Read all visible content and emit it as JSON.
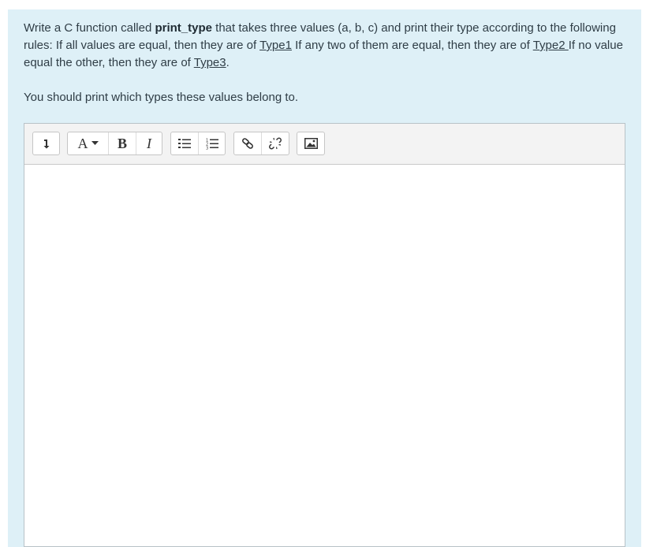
{
  "question": {
    "intro": "Write a C function called ",
    "func_name": "print_type",
    "mid1": " that takes three values (a, b, c) and print their type according to the following rules: If all values are equal, then they are of ",
    "type1": "Type1",
    "mid2": " If any two of them are equal, then they are of ",
    "type2": "Type2 ",
    "mid3": "If no value equal the other, then they are of ",
    "type3": "Type3",
    "end": ".",
    "paragraph2": "You should print which types these values belong to."
  },
  "toolbar": {
    "font_label": "A",
    "bold_label": "B",
    "italic_label": "I",
    "icons": [
      "expand-toolbar-icon",
      "font-style-icon",
      "bold-icon",
      "italic-icon",
      "unordered-list-icon",
      "ordered-list-icon",
      "link-icon",
      "unlink-icon",
      "image-icon"
    ]
  },
  "colors": {
    "panel_bg": "#def0f7",
    "toolbar_bg": "#f3f3f3",
    "text": "#2f3d46"
  }
}
